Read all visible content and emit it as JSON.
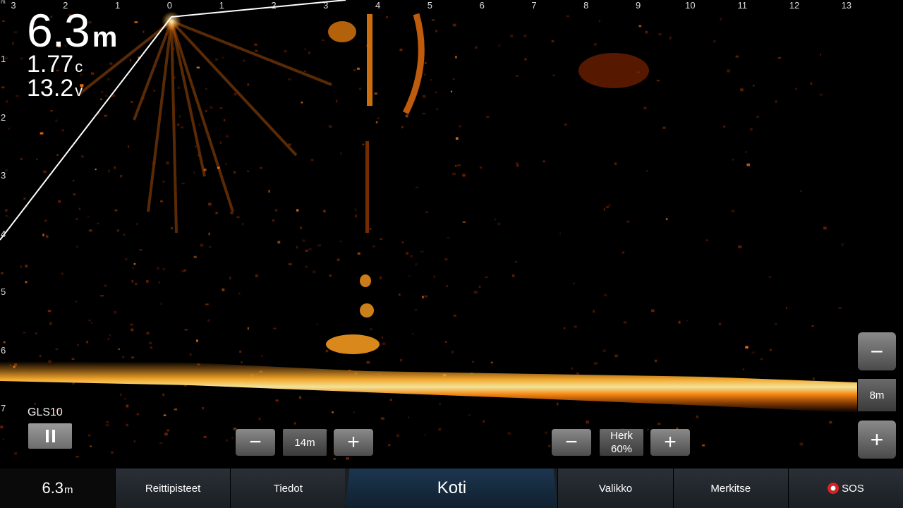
{
  "x_axis_ticks": [
    "3",
    "2",
    "1",
    "0",
    "1",
    "2",
    "3",
    "4",
    "5",
    "6",
    "7",
    "8",
    "9",
    "10",
    "11",
    "12",
    "13"
  ],
  "y_axis_ticks": [
    "1",
    "2",
    "3",
    "4",
    "5",
    "6",
    "7"
  ],
  "y_axis_corner": "m",
  "readout": {
    "depth_value": "6.3",
    "depth_unit": "m",
    "temperature_value": "1.77",
    "temperature_unit": "c",
    "voltage_value": "13.2",
    "voltage_unit": "v"
  },
  "transducer": {
    "label": "GLS10",
    "pause_icon": "pause-icon"
  },
  "range_control": {
    "minus_label": "−",
    "value": "14m",
    "plus_label": "+"
  },
  "gain_control": {
    "minus_label": "−",
    "name": "Herk",
    "value": "60%",
    "plus_label": "+"
  },
  "zoom_control": {
    "minus_label": "−",
    "value": "8m",
    "plus_label": "+"
  },
  "bottom_bar": {
    "depth_value": "6.3",
    "depth_unit": "m",
    "items": [
      {
        "label": "Reittipisteet"
      },
      {
        "label": "Tiedot"
      },
      {
        "label": "Koti"
      },
      {
        "label": "Valikko"
      },
      {
        "label": "Merkitse"
      },
      {
        "label": "SOS",
        "icon": "lifebuoy-icon"
      }
    ]
  },
  "colors": {
    "echo_hot": "#ffd060",
    "echo_mid": "#ff7a10",
    "echo_dim": "#7a2400",
    "beam_line": "#ffffff"
  }
}
